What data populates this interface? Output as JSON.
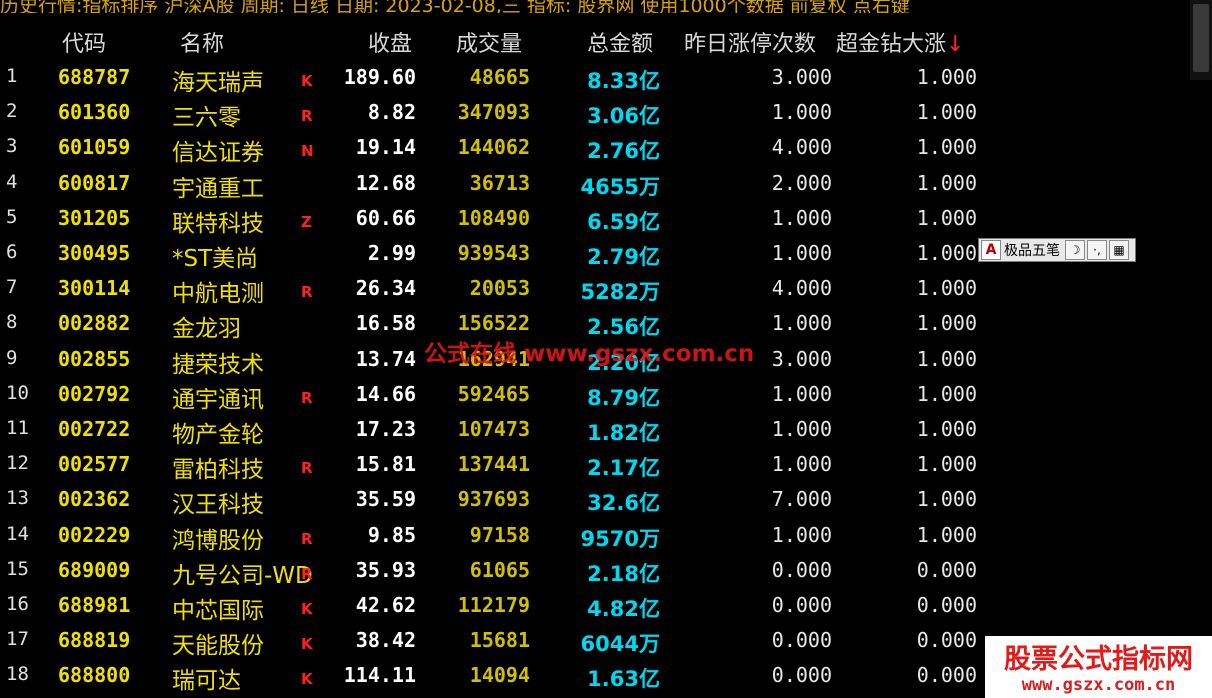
{
  "toolbar": {
    "text": "历史行情:指标排序  沪深A股  周期: 日线  日期: 2023-02-08,三  指标: 股界网  使用1000个数据  前复权  点右键"
  },
  "columns": {
    "code": "代码",
    "name": "名称",
    "close": "收盘",
    "volume": "成交量",
    "amount": "总金额",
    "zt_count": "昨日涨停次数",
    "super_gold": "超金钻大涨",
    "sort_arrow": "↓"
  },
  "rows": [
    {
      "idx": "1",
      "code": "688787",
      "name": "海天瑞声",
      "flag": "K",
      "close": "189.60",
      "volume": "48665",
      "amount": "8.33亿",
      "zt_count": "3.000",
      "super_gold": "1.000"
    },
    {
      "idx": "2",
      "code": "601360",
      "name": "三六零",
      "flag": "R",
      "close": "8.82",
      "volume": "347093",
      "amount": "3.06亿",
      "zt_count": "1.000",
      "super_gold": "1.000"
    },
    {
      "idx": "3",
      "code": "601059",
      "name": "信达证券",
      "flag": "N",
      "close": "19.14",
      "volume": "144062",
      "amount": "2.76亿",
      "zt_count": "4.000",
      "super_gold": "1.000"
    },
    {
      "idx": "4",
      "code": "600817",
      "name": "宇通重工",
      "flag": "",
      "close": "12.68",
      "volume": "36713",
      "amount": "4655万",
      "zt_count": "2.000",
      "super_gold": "1.000"
    },
    {
      "idx": "5",
      "code": "301205",
      "name": "联特科技",
      "flag": "Z",
      "close": "60.66",
      "volume": "108490",
      "amount": "6.59亿",
      "zt_count": "1.000",
      "super_gold": "1.000"
    },
    {
      "idx": "6",
      "code": "300495",
      "name": "*ST美尚",
      "flag": "",
      "close": "2.99",
      "volume": "939543",
      "amount": "2.79亿",
      "zt_count": "1.000",
      "super_gold": "1.000"
    },
    {
      "idx": "7",
      "code": "300114",
      "name": "中航电测",
      "flag": "R",
      "close": "26.34",
      "volume": "20053",
      "amount": "5282万",
      "zt_count": "4.000",
      "super_gold": "1.000"
    },
    {
      "idx": "8",
      "code": "002882",
      "name": "金龙羽",
      "flag": "",
      "close": "16.58",
      "volume": "156522",
      "amount": "2.56亿",
      "zt_count": "1.000",
      "super_gold": "1.000"
    },
    {
      "idx": "9",
      "code": "002855",
      "name": "捷荣技术",
      "flag": "",
      "close": "13.74",
      "volume": "162941",
      "amount": "2.20亿",
      "zt_count": "3.000",
      "super_gold": "1.000"
    },
    {
      "idx": "10",
      "code": "002792",
      "name": "通宇通讯",
      "flag": "R",
      "close": "14.66",
      "volume": "592465",
      "amount": "8.79亿",
      "zt_count": "1.000",
      "super_gold": "1.000"
    },
    {
      "idx": "11",
      "code": "002722",
      "name": "物产金轮",
      "flag": "",
      "close": "17.23",
      "volume": "107473",
      "amount": "1.82亿",
      "zt_count": "1.000",
      "super_gold": "1.000"
    },
    {
      "idx": "12",
      "code": "002577",
      "name": "雷柏科技",
      "flag": "R",
      "close": "15.81",
      "volume": "137441",
      "amount": "2.17亿",
      "zt_count": "1.000",
      "super_gold": "1.000"
    },
    {
      "idx": "13",
      "code": "002362",
      "name": "汉王科技",
      "flag": "",
      "close": "35.59",
      "volume": "937693",
      "amount": "32.6亿",
      "zt_count": "7.000",
      "super_gold": "1.000"
    },
    {
      "idx": "14",
      "code": "002229",
      "name": "鸿博股份",
      "flag": "R",
      "close": "9.85",
      "volume": "97158",
      "amount": "9570万",
      "zt_count": "1.000",
      "super_gold": "1.000"
    },
    {
      "idx": "15",
      "code": "689009",
      "name": "九号公司-WD",
      "flag": "R",
      "close": "35.93",
      "volume": "61065",
      "amount": "2.18亿",
      "zt_count": "0.000",
      "super_gold": "0.000"
    },
    {
      "idx": "16",
      "code": "688981",
      "name": "中芯国际",
      "flag": "K",
      "close": "42.62",
      "volume": "112179",
      "amount": "4.82亿",
      "zt_count": "0.000",
      "super_gold": "0.000"
    },
    {
      "idx": "17",
      "code": "688819",
      "name": "天能股份",
      "flag": "K",
      "close": "38.42",
      "volume": "15681",
      "amount": "6044万",
      "zt_count": "0.000",
      "super_gold": "0.000"
    },
    {
      "idx": "18",
      "code": "688800",
      "name": "瑞可达",
      "flag": "K",
      "close": "114.11",
      "volume": "14094",
      "amount": "1.63亿",
      "zt_count": "0.000",
      "super_gold": "0.000"
    }
  ],
  "watermark": "公式在线  www.gszx.com.cn",
  "ime": {
    "a": "A",
    "label": "极品五笔",
    "moon": "☽",
    "dots": "·,",
    "keyboard": "▦"
  },
  "logo": {
    "title": "股票公式指标网",
    "url": "www.gszx.com.cn"
  },
  "colors": {
    "background": "#000000",
    "code": "#f0e000",
    "amount": "#00d8f0",
    "flag": "#ff2020"
  }
}
